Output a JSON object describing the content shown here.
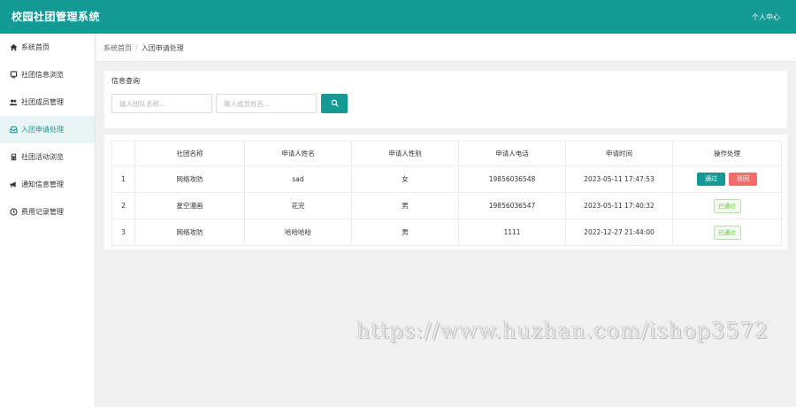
{
  "header": {
    "app_title": "校园社团管理系统",
    "user_center": "个人中心",
    "bg_color": "#139a94"
  },
  "sidebar": {
    "items": [
      {
        "label": "系统首页",
        "icon": "home-icon"
      },
      {
        "label": "社团信息浏览",
        "icon": "monitor-icon"
      },
      {
        "label": "社团成员管理",
        "icon": "users-icon"
      },
      {
        "label": "入团申请处理",
        "icon": "inbox-icon",
        "active": true
      },
      {
        "label": "社团活动浏览",
        "icon": "calculator-icon"
      },
      {
        "label": "通知信息管理",
        "icon": "bullhorn-icon"
      },
      {
        "label": "费用记录管理",
        "icon": "clock-icon"
      }
    ]
  },
  "breadcrumb": {
    "home": "系统首页",
    "separator": "/",
    "current": "入团申请处理"
  },
  "query": {
    "title": "信息查询",
    "club_name_placeholder": "输入团队名称...",
    "member_name_placeholder": "输入成员姓名...",
    "search_icon": "search-icon"
  },
  "table": {
    "headers": [
      "",
      "社团名称",
      "申请人姓名",
      "申请人性别",
      "申请人电话",
      "申请时间",
      "操作处理"
    ],
    "rows": [
      {
        "index": "1",
        "club": "网络攻防",
        "name": "sad",
        "gender": "女",
        "phone": "19856036548",
        "time": "2023-05-11 17:47:53",
        "status": "pending"
      },
      {
        "index": "2",
        "club": "星空漫画",
        "name": "花完",
        "gender": "男",
        "phone": "19856036547",
        "time": "2023-05-11 17:40:32",
        "status": "passed"
      },
      {
        "index": "3",
        "club": "网络攻防",
        "name": "哈哈哈哈",
        "gender": "男",
        "phone": "1111",
        "time": "2022-12-27 21:44:00",
        "status": "passed"
      }
    ],
    "pass_label": "通过",
    "reject_label": "驳回",
    "passed_label": "已通过"
  },
  "watermark": "https://www.huzhan.com/ishop3572"
}
